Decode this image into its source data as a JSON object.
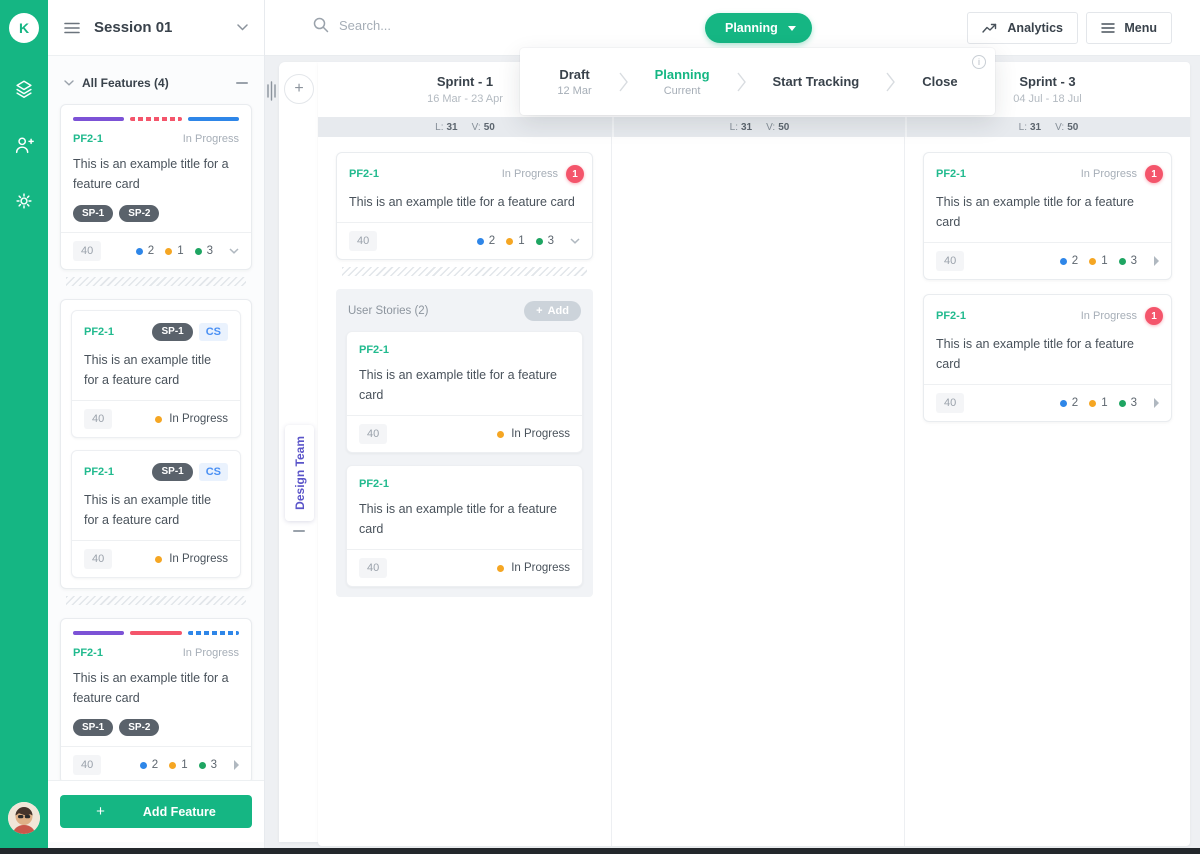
{
  "sidebar": {
    "logo": "K"
  },
  "left_panel": {
    "title": "Session 01",
    "section_label": "All Features (4)",
    "add_feature_label": "Add Feature",
    "plus_icon": "+"
  },
  "topbar": {
    "search_placeholder": "Search...",
    "planning_label": "Planning",
    "analytics_label": "Analytics",
    "menu_label": "Menu"
  },
  "workflow": {
    "stages": [
      {
        "name": "Draft",
        "sub": "12 Mar"
      },
      {
        "name": "Planning",
        "sub": "Current"
      },
      {
        "name": "Start Tracking",
        "sub": ""
      },
      {
        "name": "Close",
        "sub": ""
      }
    ],
    "info_icon": "i"
  },
  "board": {
    "team_tab": "Design Team",
    "plus_icon": "+",
    "columns": [
      {
        "title": "Sprint - 1",
        "dates": "16 Mar - 23 Apr",
        "l_label": "L:",
        "l_value": "31",
        "v_label": "V:",
        "v_value": "50"
      },
      {
        "title": "",
        "dates": "",
        "l_label": "L:",
        "l_value": "31",
        "v_label": "V:",
        "v_value": "50"
      },
      {
        "title": "Sprint - 3",
        "dates": "04 Jul - 18 Jul",
        "l_label": "L:",
        "l_value": "31",
        "v_label": "V:",
        "v_value": "50"
      }
    ],
    "user_stories_label": "User Stories (2)",
    "user_stories_add_label": "Add"
  },
  "card": {
    "id": "PF2-1",
    "status": "In Progress",
    "title": "This is an example title for a feature card",
    "tag1": "SP-1",
    "tag2": "SP-2",
    "cs_tag": "CS",
    "points": "40",
    "count_blue": "2",
    "count_orange": "1",
    "count_green": "3",
    "badge": "1"
  },
  "colors": {
    "brand_green": "#15b683",
    "team_indigo": "#5a54c9",
    "badge_red": "#f4556b",
    "dot_blue": "#2e86e8",
    "dot_orange": "#f5a623",
    "dot_green": "#1ea562"
  }
}
